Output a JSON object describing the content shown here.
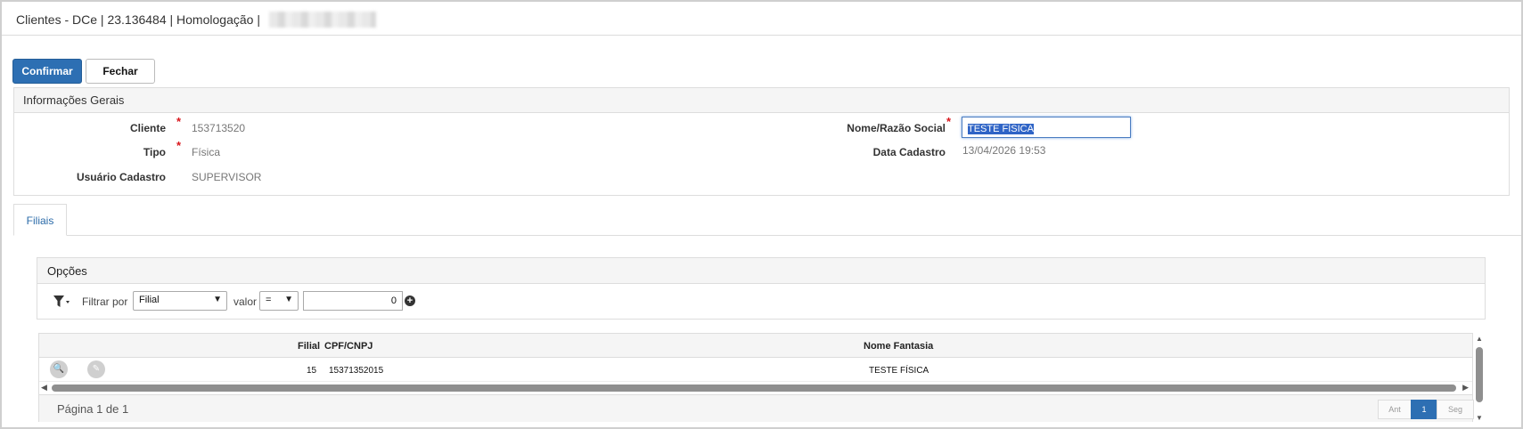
{
  "title": {
    "text": "Clientes - DCe | 23.136484 | Homologação |"
  },
  "toolbar": {
    "confirm_label": "Confirmar",
    "close_label": "Fechar"
  },
  "general": {
    "heading": "Informações Gerais",
    "required_mark": "*",
    "cliente_label": "Cliente",
    "cliente_value": "153713520",
    "tipo_label": "Tipo",
    "tipo_value": "Física",
    "usuario_label": "Usuário Cadastro",
    "usuario_value": "SUPERVISOR",
    "nome_label": "Nome/Razão Social",
    "nome_value": "TESTE FÍSICA",
    "data_label": "Data Cadastro",
    "data_value": "13/04/2026 19:53"
  },
  "tabs": [
    {
      "label": "Filiais",
      "active": true
    }
  ],
  "options": {
    "heading": "Opções",
    "filter_label": "Filtrar por",
    "filter_field": "Filial",
    "value_label": "valor",
    "operator": "=",
    "value": "0"
  },
  "grid": {
    "columns": [
      "Filial",
      "CPF/CNPJ",
      "Nome Fantasia"
    ],
    "rows": [
      {
        "filial": "15",
        "cpf_cnpj": "15371352015",
        "nome_fantasia": "TESTE FÍSICA"
      }
    ],
    "page_info": "Página 1 de 1",
    "prev_label": "Ant",
    "current_page": "1",
    "next_label": "Seg"
  },
  "colors": {
    "primary": "#2d6fb3",
    "required": "#d9161c",
    "selection": "#2f64c6"
  }
}
